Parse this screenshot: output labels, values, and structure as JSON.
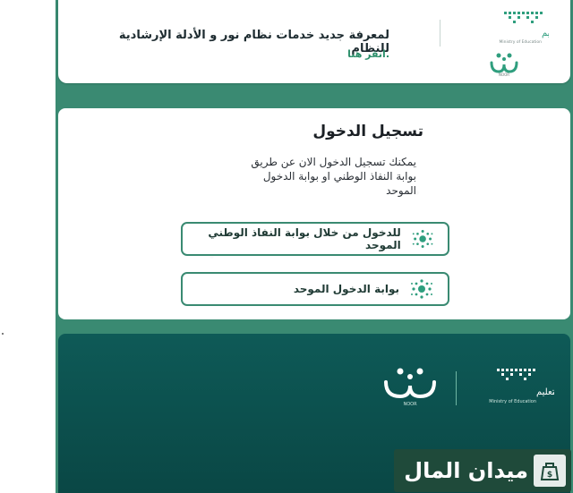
{
  "info": {
    "text": "لمعرفة جديد خدمات نظام نور و الأدلة الإرشادية للنظام",
    "link": ".انقر هنا"
  },
  "login": {
    "title": "تسجيل الدخول",
    "description": "يمكنك تسجيل الدخول الان عن طريق بوابة النفاذ الوطني او بوابة الدخول الموحد",
    "btn_nafath": "للدخول من خلال بوابة النفاذ الوطني الموحد",
    "btn_unified": "بوابة الدخول الموحد"
  },
  "brand": {
    "moe_ar": "وزارة التعليم",
    "moe_en": "Ministry of Education",
    "noor": "NOOR"
  },
  "watermark": {
    "text": "ميدان المال"
  },
  "colors": {
    "primary": "#3a8a72",
    "footer": "#0e5a57",
    "watermark_bg": "#1f4a3a"
  }
}
